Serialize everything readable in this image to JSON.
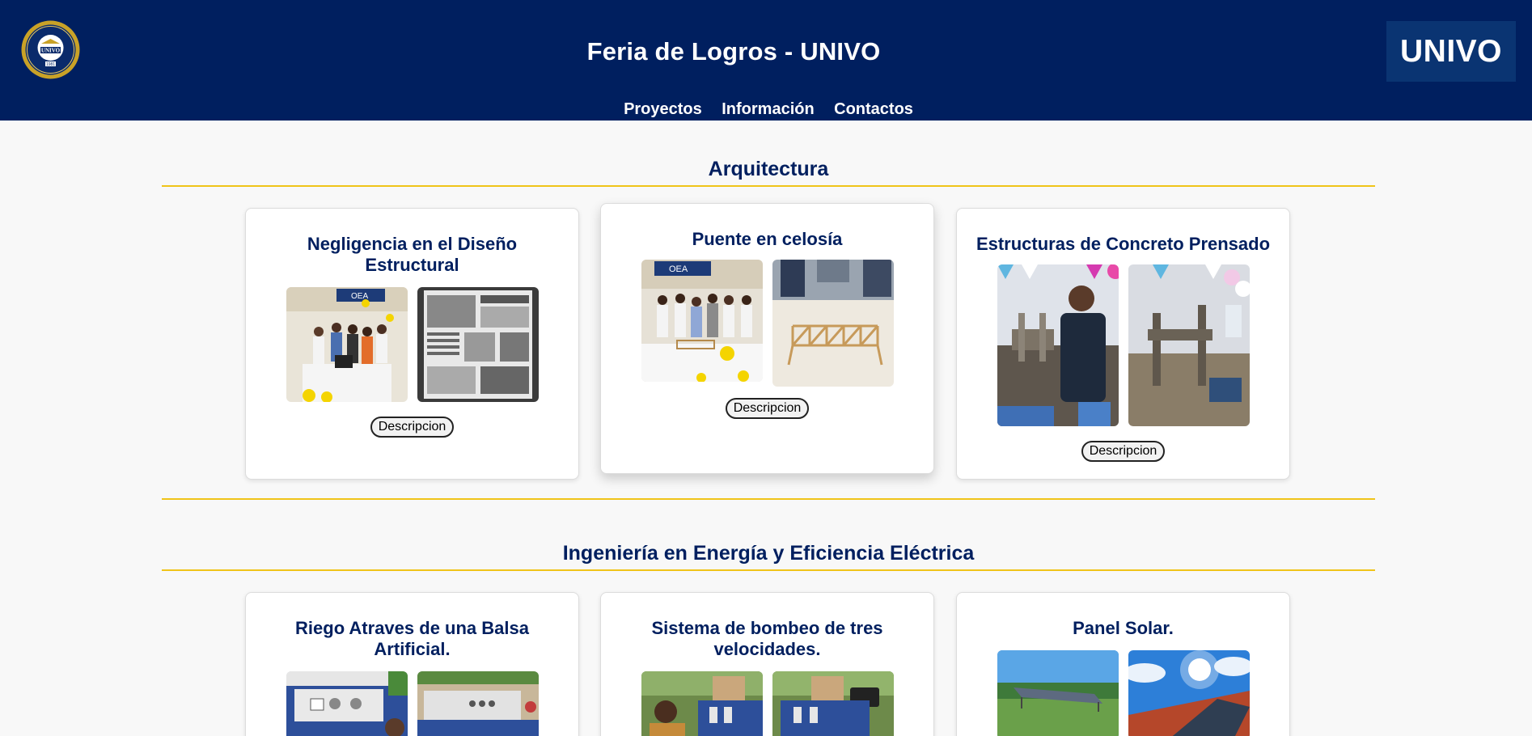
{
  "header": {
    "title": "Feria de Logros - UNIVO",
    "brand": "UNIVO",
    "logo_text": "UNIVO",
    "logo_year": "1981"
  },
  "nav": [
    {
      "label": "Proyectos"
    },
    {
      "label": "Información"
    },
    {
      "label": "Contactos"
    }
  ],
  "sections": [
    {
      "title": "Arquitectura",
      "projects": [
        {
          "title": "Negligencia en el Diseño Estructural",
          "button": "Descripcion"
        },
        {
          "title": "Puente en celosía",
          "button": "Descripcion"
        },
        {
          "title": "Estructuras de Concreto Prensado",
          "button": "Descripcion"
        }
      ]
    },
    {
      "title": "Ingeniería en Energía y Eficiencia Eléctrica",
      "projects": [
        {
          "title": "Riego Atraves de una Balsa Artificial."
        },
        {
          "title": "Sistema de bombeo de tres velocidades."
        },
        {
          "title": "Panel Solar."
        }
      ]
    }
  ],
  "photo_banner_text": "OEA",
  "colors": {
    "header_bg": "#001f5f",
    "brand_box_bg": "#0a3472",
    "accent_rule": "#f0c419",
    "title_text": "#001f5f",
    "page_bg": "#f8f8f8"
  }
}
